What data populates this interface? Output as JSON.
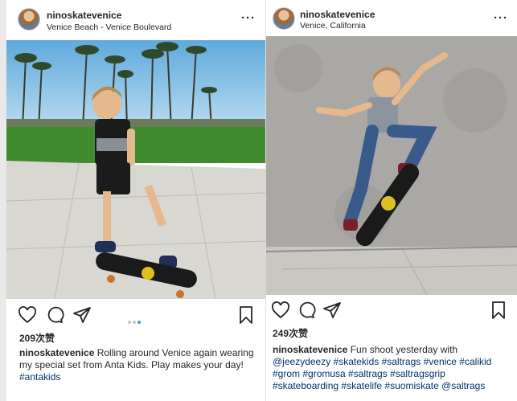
{
  "posts": [
    {
      "username": "ninoskatevenice",
      "location": "Venice Beach - Venice Boulevard",
      "more_label": "···",
      "likes": "209次赞",
      "caption_user": "ninoskatevenice",
      "caption_text": " Rolling around Venice again wearing my special set from Anta Kids. Play makes your day! ",
      "caption_tags": "#antakids",
      "carousel": {
        "count": 3,
        "active": 3
      }
    },
    {
      "username": "ninoskatevenice",
      "location": "Venice, California",
      "more_label": "···",
      "likes": "249次赞",
      "caption_user": "ninoskatevenice",
      "caption_text": " Fun shoot yesterday with ",
      "caption_tags": "@jeezydeezy #skatekids #saltrags #venice #calikid #grom #gromusa #saltrags #saltragsgrip #skateboarding #skatelife #suomiskate @saltrags"
    }
  ],
  "icons": [
    "heart-icon",
    "comment-icon",
    "share-icon",
    "bookmark-icon"
  ],
  "colors": {
    "link": "#003569",
    "carousel_active": "#3897f0"
  }
}
